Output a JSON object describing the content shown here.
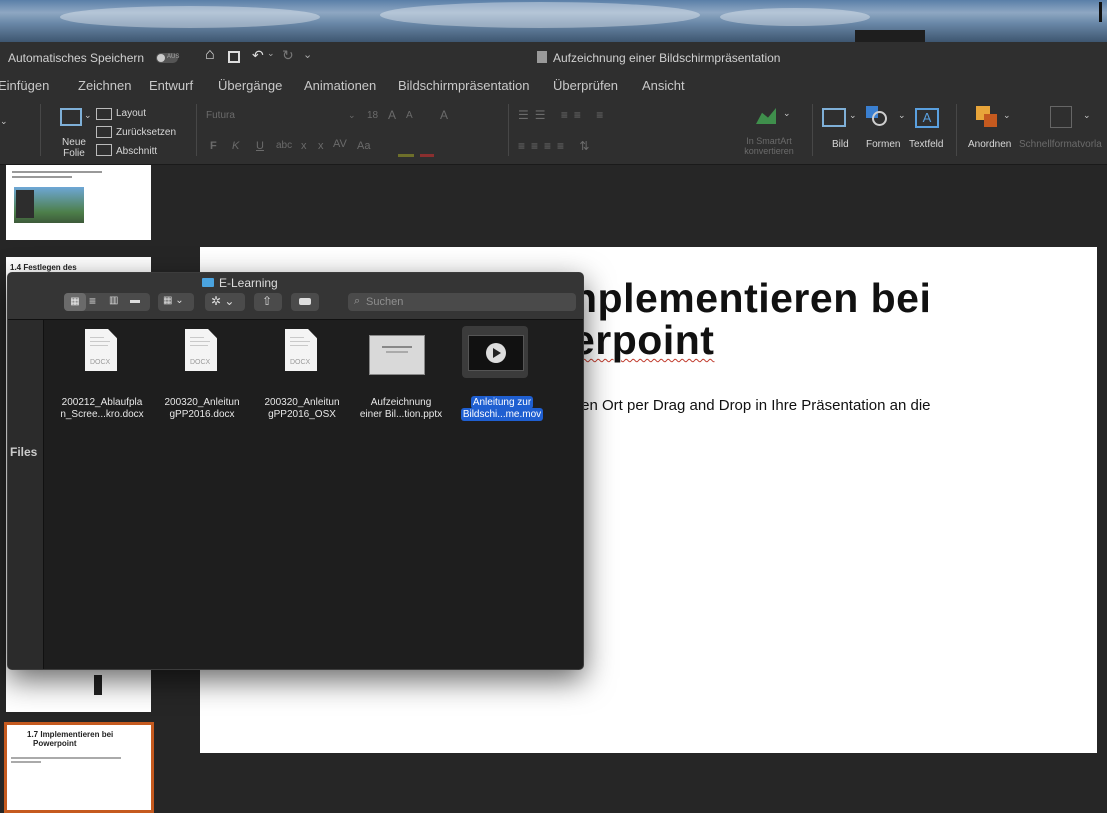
{
  "window": {
    "autosave_label": "Automatisches Speichern",
    "autosave_state": "AUS",
    "document_title": "Aufzeichnung einer Bildschirmpräsentation"
  },
  "ribbon_tabs": [
    "Einfügen",
    "Zeichnen",
    "Entwurf",
    "Übergänge",
    "Animationen",
    "Bildschirmpräsentation",
    "Überprüfen",
    "Ansicht"
  ],
  "ribbon": {
    "new_slide": "Neue\nFolie",
    "layout": "Layout",
    "reset": "Zurücksetzen",
    "section": "Abschnitt",
    "font_name": "Futura",
    "font_size": "18",
    "smartart": "In SmartArt\nkonvertieren",
    "bild": "Bild",
    "formen": "Formen",
    "textfeld": "Textfeld",
    "anordnen": "Anordnen",
    "schnellformat": "Schnellformatvorla"
  },
  "thumbnails": {
    "slide_a_label": "1.4 Festlegen des",
    "slide_b_title": "1.7 Implementieren bei",
    "slide_b_sub": "Powerpoint"
  },
  "slide": {
    "title_line1": "nplementieren bei",
    "title_line2": "erpoint",
    "body": "rten Ort per Drag and Drop in Ihre Präsentation an die"
  },
  "finder": {
    "title": "E-Learning",
    "search_placeholder": "Suchen",
    "sidebar_partial": "Files",
    "files": [
      {
        "line1": "200212_Ablaufpla",
        "line2": "n_Scree...kro.docx",
        "type": "DOCX"
      },
      {
        "line1": "200320_Anleitun",
        "line2": "gPP2016.docx",
        "type": "DOCX"
      },
      {
        "line1": "200320_Anleitun",
        "line2": "gPP2016_OSX",
        "type": "DOCX"
      },
      {
        "line1": "Aufzeichnung",
        "line2": "einer Bil...tion.pptx",
        "type": "PPTX"
      },
      {
        "line1": "Anleitung zur",
        "line2": "Bildschi...me.mov",
        "type": "MOV",
        "selected": true
      }
    ]
  },
  "colors": {
    "accent_orange": "#c55a1f",
    "selection_blue": "#1f5fd1",
    "folder_blue": "#4aa3df"
  }
}
